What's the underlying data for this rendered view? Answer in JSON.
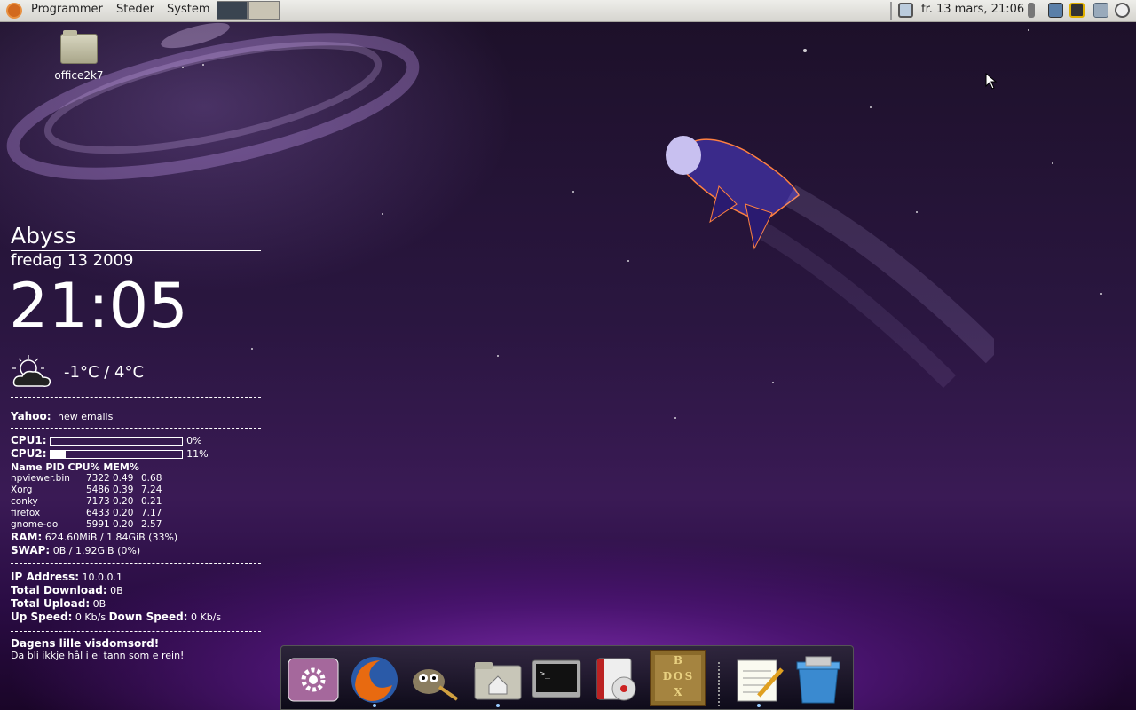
{
  "panel": {
    "menus": [
      "Programmer",
      "Steder",
      "System"
    ],
    "clock": "fr. 13 mars, 21:06",
    "icons": [
      "ubuntu-logo-icon",
      "network-icon",
      "volume-icon",
      "screen-icon",
      "lock-icon",
      "chat-icon",
      "power-icon"
    ]
  },
  "desktop": {
    "icon_label": "office2k7"
  },
  "conky": {
    "hostname": "Abyss",
    "date": "fredag 13 2009",
    "time": "21:05",
    "weather": "-1°C / 4°C",
    "weather_icon": "partly-cloudy-icon",
    "yahoo_label": "Yahoo:",
    "yahoo_value": "new emails",
    "cpu1_label": "CPU1:",
    "cpu1_value": "0%",
    "cpu1_level": 0,
    "cpu2_label": "CPU2:",
    "cpu2_value": "11%",
    "cpu2_level": 0.11,
    "proc_header": "Name PID CPU% MEM%",
    "processes": [
      {
        "name": "npviewer.bin",
        "pid": "7322",
        "cpu": "0.49",
        "mem": "0.68"
      },
      {
        "name": "Xorg",
        "pid": "5486",
        "cpu": "0.39",
        "mem": "7.24"
      },
      {
        "name": "conky",
        "pid": "7173",
        "cpu": "0.20",
        "mem": "0.21"
      },
      {
        "name": "firefox",
        "pid": "6433",
        "cpu": "0.20",
        "mem": "7.17"
      },
      {
        "name": "gnome-do",
        "pid": "5991",
        "cpu": "0.20",
        "mem": "2.57"
      }
    ],
    "ram_label": "RAM:",
    "ram_value": "624.60MiB / 1.84GiB (33%)",
    "swap_label": "SWAP:",
    "swap_value": "0B / 1.92GiB (0%)",
    "ip_label": "IP Address:",
    "ip_value": "10.0.0.1",
    "dl_label": "Total Download:",
    "dl_value": "0B",
    "ul_label": "Total Upload:",
    "ul_value": "0B",
    "up_speed_label": "Up Speed:",
    "up_speed_value": "0 Kb/s",
    "down_speed_label": "Down Speed:",
    "down_speed_value": "0 Kb/s",
    "quote_title": "Dagens lille visdomsord!",
    "quote_text": "Da bli ikkje hål i ei tann som e rein!"
  },
  "dock": {
    "items": [
      "settings-icon",
      "firefox-icon",
      "gimp-icon",
      "home-folder-icon",
      "terminal-icon",
      "disc-burner-icon",
      "dosbox-icon",
      "text-editor-icon",
      "trash-icon"
    ],
    "dosbox_text": "BDOSX"
  }
}
